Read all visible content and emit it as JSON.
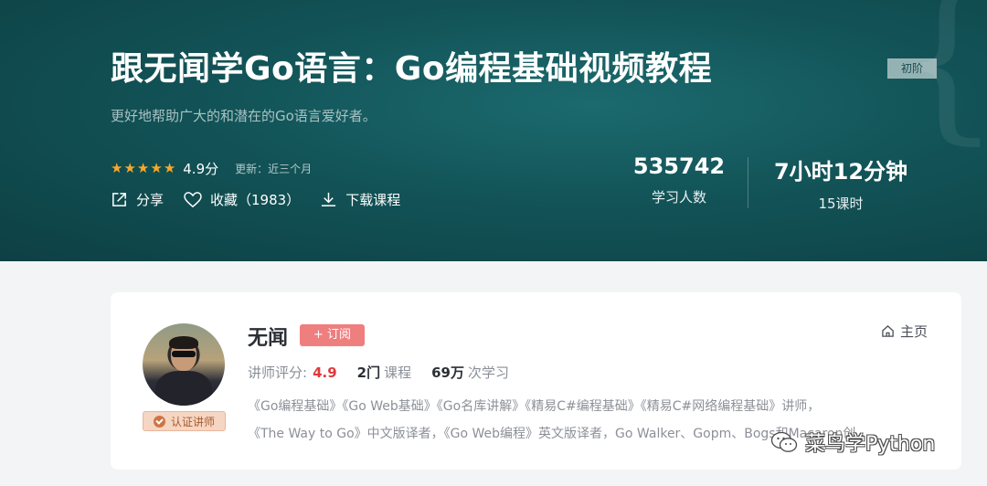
{
  "course": {
    "title": "跟无闻学Go语言：Go编程基础视频教程",
    "level": "初阶",
    "subtitle": "更好地帮助广大的和潜在的Go语言爱好者。",
    "rating": {
      "stars": 5,
      "score": "4.9分",
      "update": "更新：近三个月"
    },
    "actions": {
      "share": "分享",
      "favorite": "收藏（1983）",
      "download": "下载课程"
    },
    "stats": [
      {
        "value": "535742",
        "label": "学习人数"
      },
      {
        "value": "7小时12分钟",
        "label": "15课时"
      }
    ]
  },
  "teacher": {
    "name": "无闻",
    "subscribe": "+ 订阅",
    "home": "主页",
    "cert": "认证讲师",
    "rating_label": "讲师评分:",
    "rating_value": "4.9",
    "courses_num": "2门",
    "courses_label": "课程",
    "learn_num": "69万",
    "learn_label": "次学习",
    "bio_line1": "《Go编程基础》《Go Web基础》《Go名库讲解》《精易C#编程基础》《精易C#网络编程基础》讲师，",
    "bio_line2": "《The Way to Go》中文版译者，《Go Web编程》英文版译者，Go Walker、Gopm、Bogs和Macaron创"
  },
  "watermark": {
    "text": "菜鸟学Python",
    "icon": "wechat-icon"
  },
  "colors": {
    "hero": "#125357",
    "star": "#f7a829",
    "subscribe": "#ef7e7e",
    "rating": "#e0393e"
  }
}
